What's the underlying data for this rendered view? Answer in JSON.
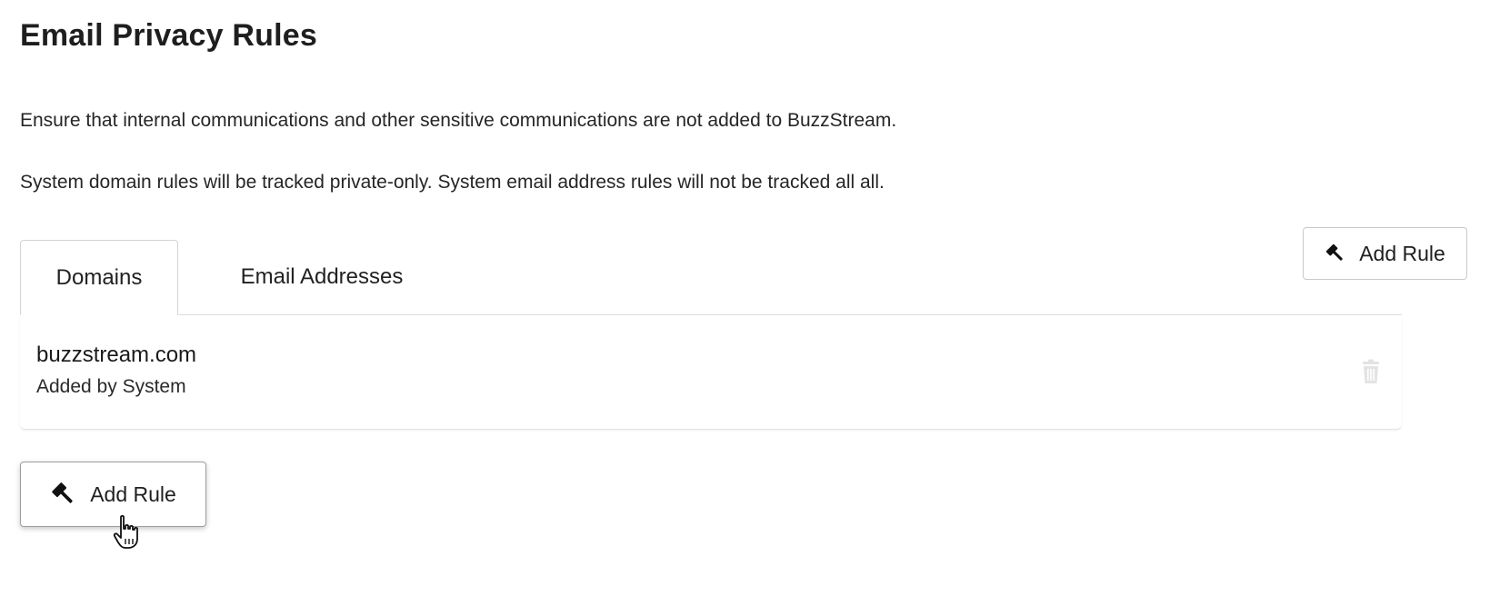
{
  "page": {
    "title": "Email Privacy Rules",
    "description_1": "Ensure that internal communications and other sensitive communications are not added to BuzzStream.",
    "description_2": "System domain rules will be tracked private-only. System email address rules will not be tracked all all."
  },
  "tabs": [
    {
      "label": "Domains",
      "active": true
    },
    {
      "label": "Email Addresses",
      "active": false
    }
  ],
  "buttons": {
    "add_rule_top": {
      "label": "Add Rule",
      "icon": "gavel-icon"
    },
    "add_rule_bottom": {
      "label": "Add Rule",
      "icon": "gavel-icon"
    }
  },
  "rules": [
    {
      "domain": "buzzstream.com",
      "added_by": "Added by System",
      "action_icon": "trash-icon"
    }
  ],
  "colors": {
    "text": "#222222",
    "border": "#d4d4d4",
    "trash_icon": "#e3e3e3"
  }
}
